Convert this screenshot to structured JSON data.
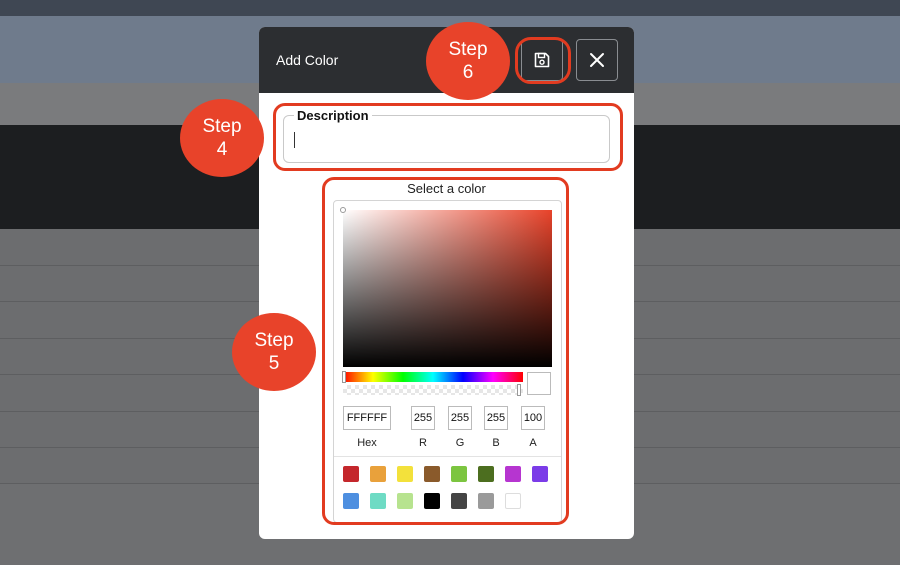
{
  "dialog": {
    "title": "Add Color",
    "description_label": "Description",
    "description_value": "",
    "picker_title": "Select a color"
  },
  "picker": {
    "hue_color": "#e8432a",
    "fields": [
      {
        "label": "Hex",
        "value": "FFFFFF"
      },
      {
        "label": "R",
        "value": "255"
      },
      {
        "label": "G",
        "value": "255"
      },
      {
        "label": "B",
        "value": "255"
      },
      {
        "label": "A",
        "value": "100"
      }
    ],
    "swatches": [
      "#c4272c",
      "#e9a13b",
      "#f3e13b",
      "#8a5a2b",
      "#7cc540",
      "#4c6e1f",
      "#b635d0",
      "#7b3ce8",
      "#4e8fe0",
      "#6edbc4",
      "#b7e38f",
      "#000000",
      "#444444",
      "#9a9a9a",
      "#ffffff"
    ]
  },
  "icons": {
    "save": "save-icon",
    "close": "close-icon"
  },
  "annotations": {
    "step4": "Step 4",
    "step5": "Step 5",
    "step6": "Step 6",
    "annotation_color": "#e8432a"
  }
}
